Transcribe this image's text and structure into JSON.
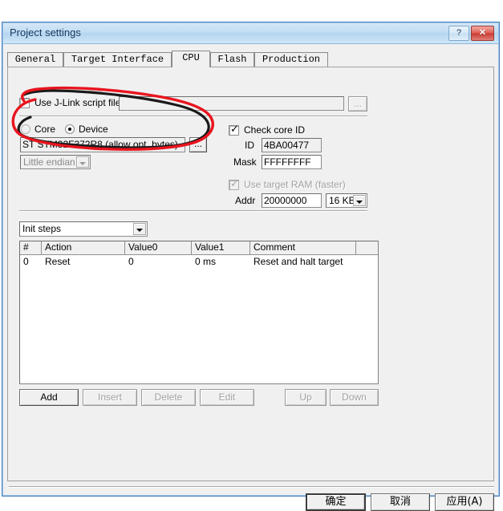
{
  "window": {
    "title": "Project settings",
    "help_button": "?",
    "close_button": "✕"
  },
  "tabs": [
    {
      "label": "General",
      "active": false
    },
    {
      "label": "Target Interface",
      "active": false
    },
    {
      "label": "CPU",
      "active": true
    },
    {
      "label": "Flash",
      "active": false
    },
    {
      "label": "Production",
      "active": false
    }
  ],
  "cpu_tab": {
    "script_file": {
      "checkbox_label": "Use J-Link script file",
      "checked": false,
      "value": "",
      "placeholder": "",
      "browse_button": "..."
    },
    "core_device": {
      "core_radio_label": "Core",
      "device_radio_label": "Device",
      "selected": "Device",
      "device_value": "ST STM32F372R8 (allow opt. bytes)",
      "device_browse_button": "...",
      "endian_value": "Little endian",
      "endian_enabled": false
    },
    "core_id": {
      "checkbox_label": "Check core ID",
      "checked": true,
      "id_label": "ID",
      "id_value": "4BA00477",
      "mask_label": "Mask",
      "mask_value": "FFFFFFFF"
    },
    "target_ram": {
      "checkbox_label": "Use target RAM (faster)",
      "checked": true,
      "enabled": false,
      "addr_label": "Addr",
      "addr_value": "20000000",
      "size_value": "16 KB"
    },
    "init_steps": {
      "selector_value": "Init steps",
      "columns": [
        "#",
        "Action",
        "Value0",
        "Value1",
        "Comment",
        ""
      ],
      "rows": [
        {
          "num": "0",
          "action": "Reset",
          "value0": "0",
          "value1": "0 ms",
          "comment": "Reset and halt target"
        }
      ],
      "buttons": [
        {
          "label": "Add",
          "enabled": true
        },
        {
          "label": "Insert",
          "enabled": false
        },
        {
          "label": "Delete",
          "enabled": false
        },
        {
          "label": "Edit",
          "enabled": false
        },
        {
          "label": "Up",
          "enabled": false
        },
        {
          "label": "Down",
          "enabled": false
        }
      ]
    }
  },
  "dialog_buttons": {
    "ok": "确定",
    "cancel": "取消",
    "apply": "应用(A)"
  },
  "annotation": {
    "red_color": "#e8141e",
    "black_color": "#1a1a1a",
    "shape": "hand-drawn-ellipse"
  },
  "colors": {
    "window_border": "#4a7ebb",
    "title_gradient_top": "#d4e7f7",
    "title_gradient_bottom": "#cfe6f8",
    "dialog_face": "#f0f0f0",
    "close_red": "#c93a31"
  }
}
